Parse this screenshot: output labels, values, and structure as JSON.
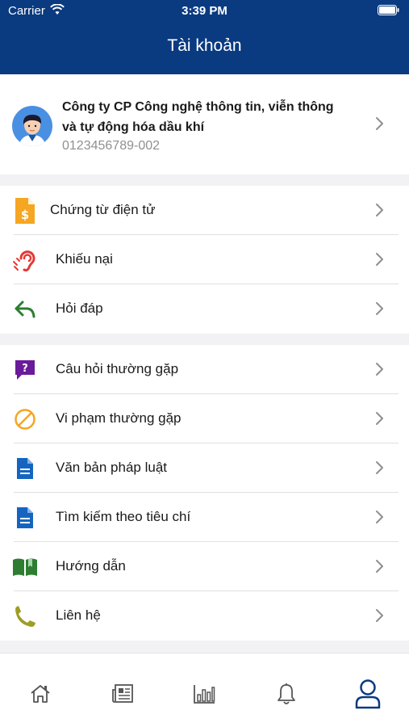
{
  "status_bar": {
    "carrier": "Carrier",
    "time": "3:39 PM"
  },
  "header": {
    "title": "Tài khoản"
  },
  "profile": {
    "company_line1": "Công ty CP Công nghệ thông tin, viễn thông",
    "company_line2": "và tự động hóa dầu khí",
    "tax_code": "0123456789-002"
  },
  "group1": [
    {
      "label": "Chứng từ điện tử",
      "icon": "invoice-dollar-icon",
      "color": "#f5a623"
    },
    {
      "label": "Khiếu nại",
      "icon": "hearing-icon",
      "color": "#e53935"
    },
    {
      "label": "Hỏi đáp",
      "icon": "reply-icon",
      "color": "#2e7d32"
    }
  ],
  "group2": [
    {
      "label": "Câu hỏi thường gặp",
      "icon": "question-bubble-icon",
      "color": "#6a1b9a"
    },
    {
      "label": "Vi phạm thường gặp",
      "icon": "prohibited-icon",
      "color": "#f5a623"
    },
    {
      "label": "Văn bản pháp luật",
      "icon": "document-icon",
      "color": "#1565c0"
    },
    {
      "label": "Tìm kiếm theo tiêu chí",
      "icon": "document-search-icon",
      "color": "#1565c0"
    },
    {
      "label": "Hướng dẫn",
      "icon": "book-icon",
      "color": "#2e7d32"
    },
    {
      "label": "Liên hệ",
      "icon": "phone-icon",
      "color": "#9e9d24"
    }
  ],
  "tabbar": {
    "tabs": [
      "home-icon",
      "news-icon",
      "chart-icon",
      "bell-icon",
      "user-icon"
    ],
    "active_color": "#0a3a80",
    "inactive_color": "#555555"
  }
}
